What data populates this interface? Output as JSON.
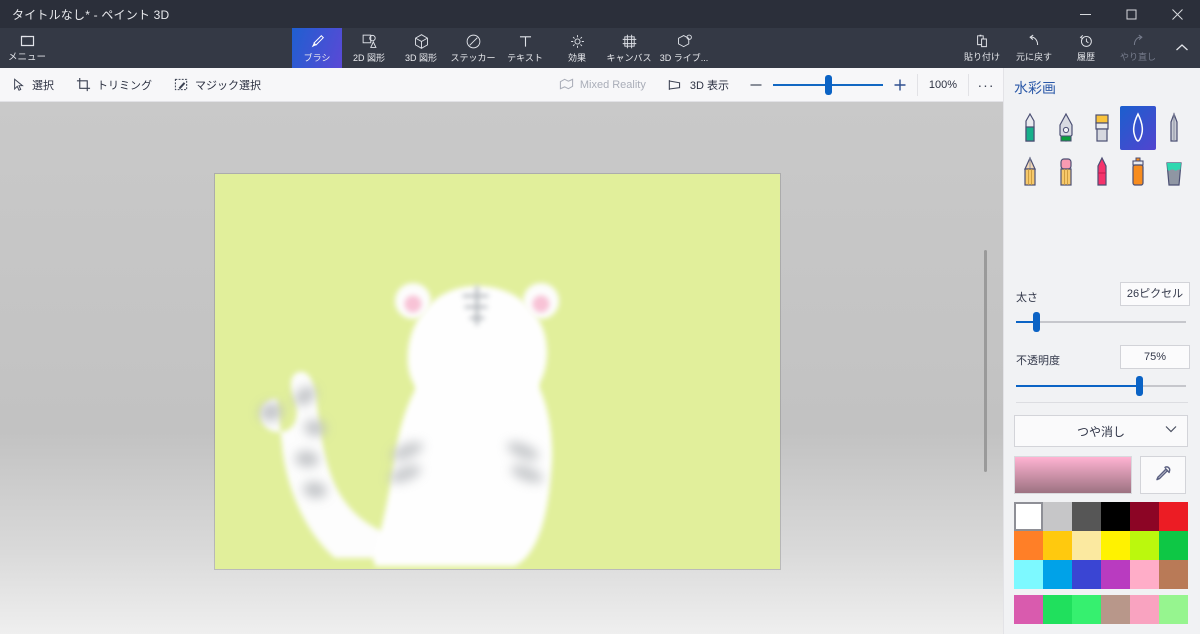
{
  "window": {
    "title": "タイトルなし* - ペイント 3D",
    "controls": [
      {
        "name": "minimize",
        "glyph": "─"
      },
      {
        "name": "restore",
        "glyph": "❐"
      },
      {
        "name": "close",
        "glyph": "✕"
      }
    ]
  },
  "ribbon": {
    "menu_label": "メニュー",
    "tabs": [
      {
        "label": "ブラシ",
        "icon": "brush-icon",
        "active": true
      },
      {
        "label": "2D 図形",
        "icon": "shapes-2d-icon",
        "active": false
      },
      {
        "label": "3D 図形",
        "icon": "shapes-3d-icon",
        "active": false
      },
      {
        "label": "ステッカー",
        "icon": "sticker-icon",
        "active": false
      },
      {
        "label": "テキスト",
        "icon": "text-icon",
        "active": false
      },
      {
        "label": "効果",
        "icon": "effects-icon",
        "active": false
      },
      {
        "label": "キャンバス",
        "icon": "canvas-icon",
        "active": false
      },
      {
        "label": "3D ライブ...",
        "icon": "remix-3d-icon",
        "active": false
      }
    ],
    "right_buttons": [
      {
        "label": "貼り付け",
        "icon": "paste-icon",
        "disabled": false
      },
      {
        "label": "元に戻す",
        "icon": "undo-icon",
        "disabled": false
      },
      {
        "label": "履歴",
        "icon": "history-icon",
        "disabled": false
      },
      {
        "label": "やり直し",
        "icon": "redo-icon",
        "disabled": true
      }
    ],
    "collapse_icon": "chevron-up-icon"
  },
  "subtoolbar": {
    "left_items": [
      {
        "label": "選択",
        "icon": "cursor-select-icon",
        "disabled": false
      },
      {
        "label": "トリミング",
        "icon": "crop-icon",
        "disabled": false
      },
      {
        "label": "マジック選択",
        "icon": "magic-select-icon",
        "disabled": false
      }
    ],
    "right_items": [
      {
        "label": "Mixed Reality",
        "icon": "mixed-reality-icon",
        "disabled": true
      },
      {
        "label": "3D 表示",
        "icon": "view-3d-icon",
        "disabled": false
      }
    ],
    "zoom": {
      "minus": "−",
      "plus": "+",
      "percent": "100%",
      "slider_value": 50
    },
    "more_label": "···"
  },
  "canvas": {
    "background_color": "#e1ef9b",
    "workspace_color": "#c5c5c5",
    "artwork_name": "white-tiger-cat-drawing",
    "scrollbar": {
      "name": "vertical-scrollbar"
    }
  },
  "panel": {
    "title": "水彩画",
    "brushes": [
      {
        "name": "marker-brush",
        "selected": false
      },
      {
        "name": "calligraphy-pen-brush",
        "selected": false
      },
      {
        "name": "oil-brush",
        "selected": false
      },
      {
        "name": "watercolor-brush",
        "selected": true
      },
      {
        "name": "pixel-pen-brush",
        "selected": false
      },
      {
        "name": "pencil-brush",
        "selected": false
      },
      {
        "name": "eraser-brush",
        "selected": false
      },
      {
        "name": "crayon-brush",
        "selected": false
      },
      {
        "name": "spray-can-brush",
        "selected": false
      },
      {
        "name": "fill-bucket-brush",
        "selected": false
      }
    ],
    "thickness": {
      "label": "太さ",
      "value": "26ピクセル",
      "slider_percent": 10
    },
    "opacity": {
      "label": "不透明度",
      "value": "75%",
      "slider_percent": 71
    },
    "material": {
      "value": "つや消し",
      "chevron": "⌄"
    },
    "current_color": {
      "top": "#ffb3d2",
      "bottom": "#9c7281"
    },
    "eyedropper": {
      "name": "eyedropper-icon"
    },
    "palette_rows": [
      [
        "#ffffff",
        "#c6c6c8",
        "#565656",
        "#000000",
        "#8c0525",
        "#ec1c24"
      ],
      [
        "#ff7f27",
        "#ffc90e",
        "#fbe9a0",
        "#fff200",
        "#bbf80d",
        "#0ec745"
      ],
      [
        "#7df9ff",
        "#00a2e8",
        "#3a45d3",
        "#b93bc0",
        "#ffadc8",
        "#b97a57"
      ]
    ],
    "palette_selected": {
      "row": 0,
      "col": 0
    },
    "recent_colors": [
      "#d95bae",
      "#20e05d",
      "#36f06f",
      "#b8978a",
      "#f9a3c0",
      "#96f58f"
    ]
  }
}
